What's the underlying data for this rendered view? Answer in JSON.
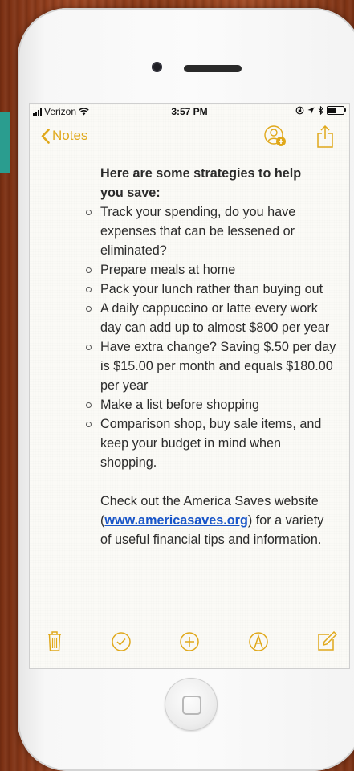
{
  "status_bar": {
    "carrier": "Verizon",
    "time": "3:57 PM"
  },
  "navbar": {
    "back_label": "Notes",
    "accent_color": "#e0a81a"
  },
  "note": {
    "title_line1": "Here  are some strategies to help",
    "title_line2": "you save:",
    "items": [
      "Track your spending, do you have expenses that can be lessened or eliminated?",
      "Prepare meals at home",
      "Pack your lunch rather than buying out",
      "A daily cappuccino or latte every work day can add up to almost $800 per year",
      "Have extra change? Saving $.50 per day is $15.00 per month and equals $180.00 per year",
      "Make a list before shopping",
      "Comparison shop, buy sale items, and keep your budget in mind when shopping."
    ],
    "footer_before": "Check out the America Saves website (",
    "link_text": "www.americasaves.org",
    "footer_after": ") for a variety of useful financial tips and information."
  },
  "toolbar": {
    "icons": [
      "trash-icon",
      "checklist-icon",
      "add-icon",
      "markup-icon",
      "compose-icon"
    ]
  }
}
